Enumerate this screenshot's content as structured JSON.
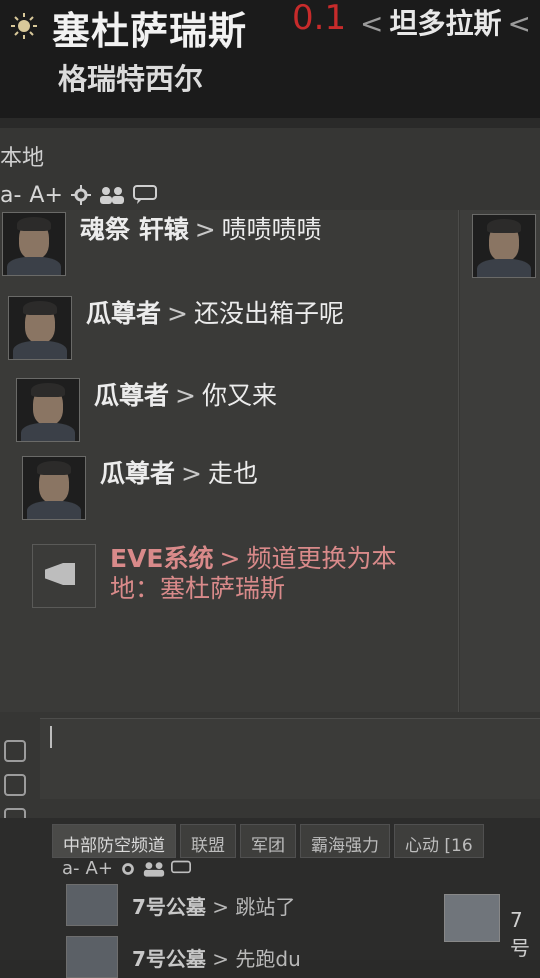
{
  "header": {
    "system_name": "塞杜萨瑞斯",
    "security": "0.1",
    "route_prefix": "<",
    "route_next": "坦多拉斯",
    "route_suffix": "<",
    "region": "格瑞特西尔",
    "security_color": "#c72b2b"
  },
  "chat": {
    "title": "本地",
    "toolbar": {
      "font_decrease": "a-",
      "font_increase": "A+",
      "icons": [
        "settings-gear-icon",
        "members-icon",
        "speech-bubble-icon"
      ]
    },
    "messages": [
      {
        "sender": "魂祭 轩辕",
        "separator": ">",
        "text": "啧啧啧啧",
        "avatar": "pilot-portrait"
      },
      {
        "sender": "瓜尊者",
        "separator": ">",
        "text": "还没出箱子呢",
        "avatar": "pilot-portrait"
      },
      {
        "sender": "瓜尊者",
        "separator": ">",
        "text": "你又来",
        "avatar": "pilot-portrait"
      },
      {
        "sender": "瓜尊者",
        "separator": ">",
        "text": "走也",
        "avatar": "pilot-portrait"
      }
    ],
    "system_message": {
      "sender": "EVE系统",
      "separator": ">",
      "text_line1": "频道更换为本",
      "text_line2": "地：塞杜萨瑞斯",
      "icon": "megaphone-icon",
      "color": "#d98a8a"
    },
    "input": {
      "value": ""
    }
  },
  "bottom_chat": {
    "tabs": [
      "中部防空频道",
      "联盟",
      "军团",
      "霸海强力",
      "心动 [16"
    ],
    "active_tab": "中部防空频道",
    "toolbar": {
      "font_decrease": "a-",
      "font_increase": "A+"
    },
    "messages": [
      {
        "sender": "7号公墓",
        "separator": ">",
        "text": "跳站了"
      },
      {
        "sender": "7号公墓",
        "separator": ">",
        "text": "先跑du"
      }
    ],
    "member_label": "7号"
  }
}
